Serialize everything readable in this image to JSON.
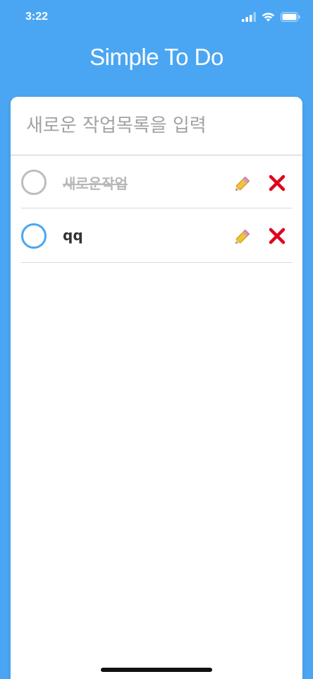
{
  "status_bar": {
    "time": "3:22",
    "icons": [
      "cellular-signal-icon",
      "wifi-icon",
      "battery-icon"
    ]
  },
  "app": {
    "title": "Simple To Do"
  },
  "new_task_input": {
    "placeholder": "새로운 작업목록을 입력",
    "value": ""
  },
  "tasks": [
    {
      "text": "새로운작업",
      "completed": true,
      "edit_icon": "pencil-icon",
      "delete_icon": "close-icon"
    },
    {
      "text": "qq",
      "completed": false,
      "edit_icon": "pencil-icon",
      "delete_icon": "close-icon"
    }
  ],
  "colors": {
    "background": "#4aa6f2",
    "card": "#ffffff",
    "active_circle": "#4aa6f2",
    "inactive_circle": "#bdbdbd",
    "delete": "#e0001b",
    "pencil": "#f3c336"
  }
}
